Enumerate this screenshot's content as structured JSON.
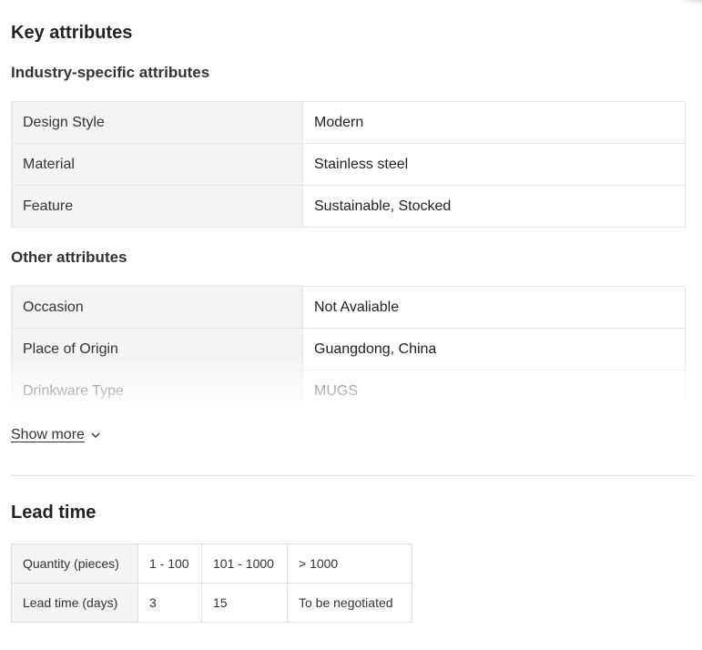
{
  "key_attributes": {
    "title": "Key attributes",
    "industry": {
      "title": "Industry-specific attributes",
      "rows": [
        {
          "key": "Design Style",
          "value": "Modern"
        },
        {
          "key": "Material",
          "value": "Stainless steel"
        },
        {
          "key": "Feature",
          "value": "Sustainable, Stocked"
        }
      ]
    },
    "other": {
      "title": "Other attributes",
      "rows": [
        {
          "key": "Occasion",
          "value": "Not Avaliable"
        },
        {
          "key": "Place of Origin",
          "value": "Guangdong, China"
        },
        {
          "key": "Drinkware Type",
          "value": "MUGS"
        }
      ]
    },
    "show_more": "Show more"
  },
  "lead_time": {
    "title": "Lead time",
    "header": [
      "Quantity (pieces)",
      "1 - 100",
      "101 - 1000",
      "> 1000"
    ],
    "row": [
      "Lead time (days)",
      "3",
      "15",
      "To be negotiated"
    ]
  }
}
